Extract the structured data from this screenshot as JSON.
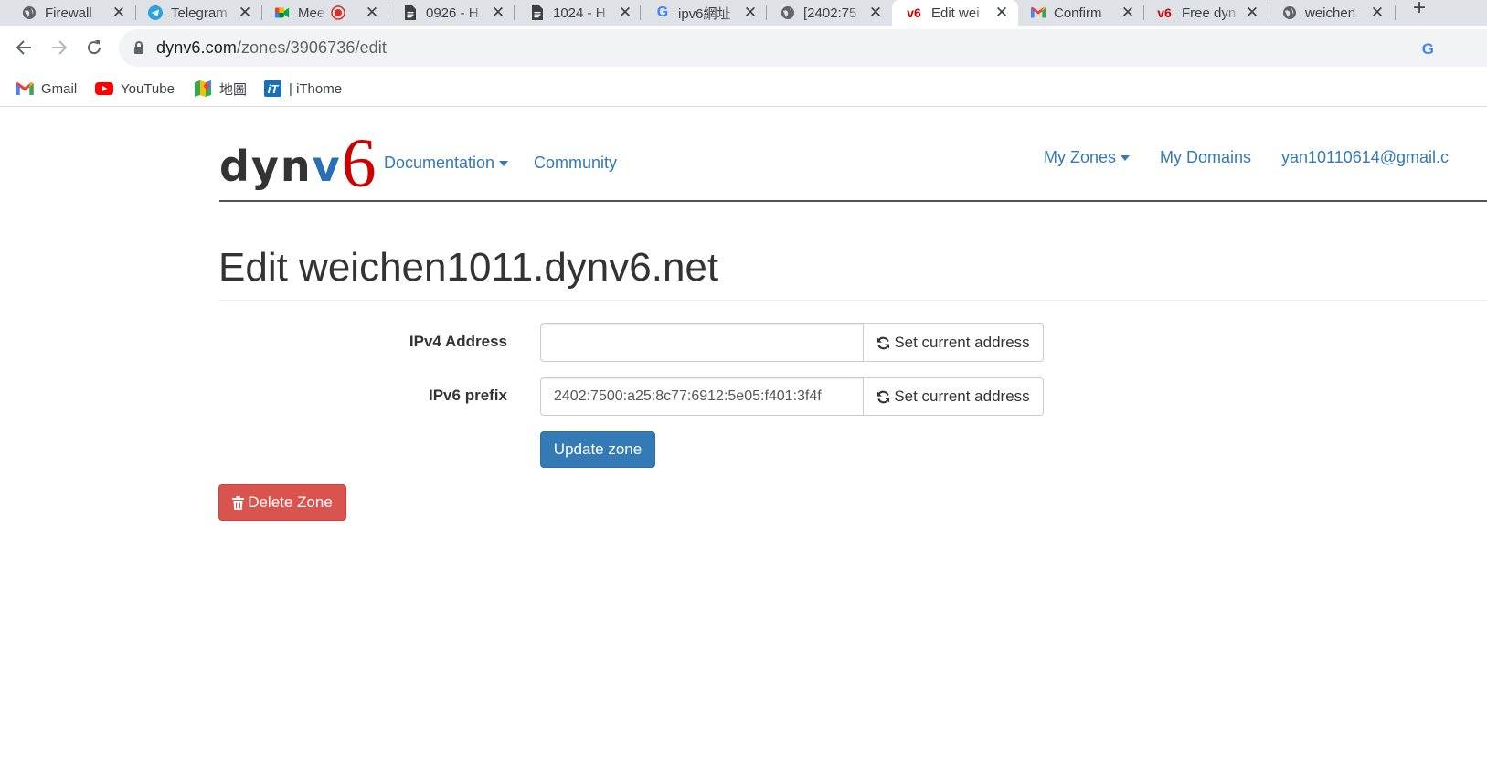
{
  "browser": {
    "tabs": [
      {
        "title": "Firewall",
        "icon": "globe-icon"
      },
      {
        "title": "Telegram",
        "icon": "telegram-icon"
      },
      {
        "title": "Mee",
        "icon": "meet-icon",
        "recording": true
      },
      {
        "title": "0926 - H",
        "icon": "doc-icon"
      },
      {
        "title": "1024 - H",
        "icon": "doc-icon"
      },
      {
        "title": "ipv6網址",
        "icon": "google-icon"
      },
      {
        "title": "[2402:75",
        "icon": "globe-icon"
      },
      {
        "title": "Edit wei",
        "icon": "dynv6-icon",
        "active": true
      },
      {
        "title": "Confirm",
        "icon": "gmail-icon"
      },
      {
        "title": "Free dyn",
        "icon": "dynv6-icon"
      },
      {
        "title": "weichen",
        "icon": "globe-icon"
      }
    ],
    "tab_icon_text": {
      "dynv6": "v6",
      "google": "G"
    },
    "close_glyph": "✕",
    "new_tab_glyph": "+",
    "address": {
      "host": "dynv6.com",
      "path": "/zones/3906736/edit"
    },
    "omnibox_icon_text": "G",
    "bookmarks": [
      {
        "label": "Gmail",
        "icon": "gmail-icon"
      },
      {
        "label": "YouTube",
        "icon": "youtube-icon"
      },
      {
        "label": "地圖",
        "icon": "maps-icon"
      },
      {
        "label": "| iThome",
        "icon": "ithome-icon",
        "icon_text": "iT"
      }
    ]
  },
  "site": {
    "logo": {
      "part1": "dyn",
      "part2": "v",
      "part3": "6"
    },
    "nav": {
      "documentation": "Documentation",
      "community": "Community",
      "my_zones": "My Zones",
      "my_domains": "My Domains",
      "user": "yan10110614@gmail.c"
    }
  },
  "page": {
    "title": "Edit weichen1011.dynv6.net",
    "ipv4": {
      "label": "IPv4 Address",
      "value": "",
      "button": "Set current address"
    },
    "ipv6": {
      "label": "IPv6 prefix",
      "value": "2402:7500:a25:8c77:6912:5e05:f401:3f4f",
      "button": "Set current address"
    },
    "update_button": "Update zone",
    "delete_button": "Delete Zone"
  },
  "colors": {
    "link": "#337ab7",
    "primary": "#337ab7",
    "danger": "#d9534f",
    "logo_v": "#2a6fb3",
    "logo_6": "#cc0000"
  }
}
